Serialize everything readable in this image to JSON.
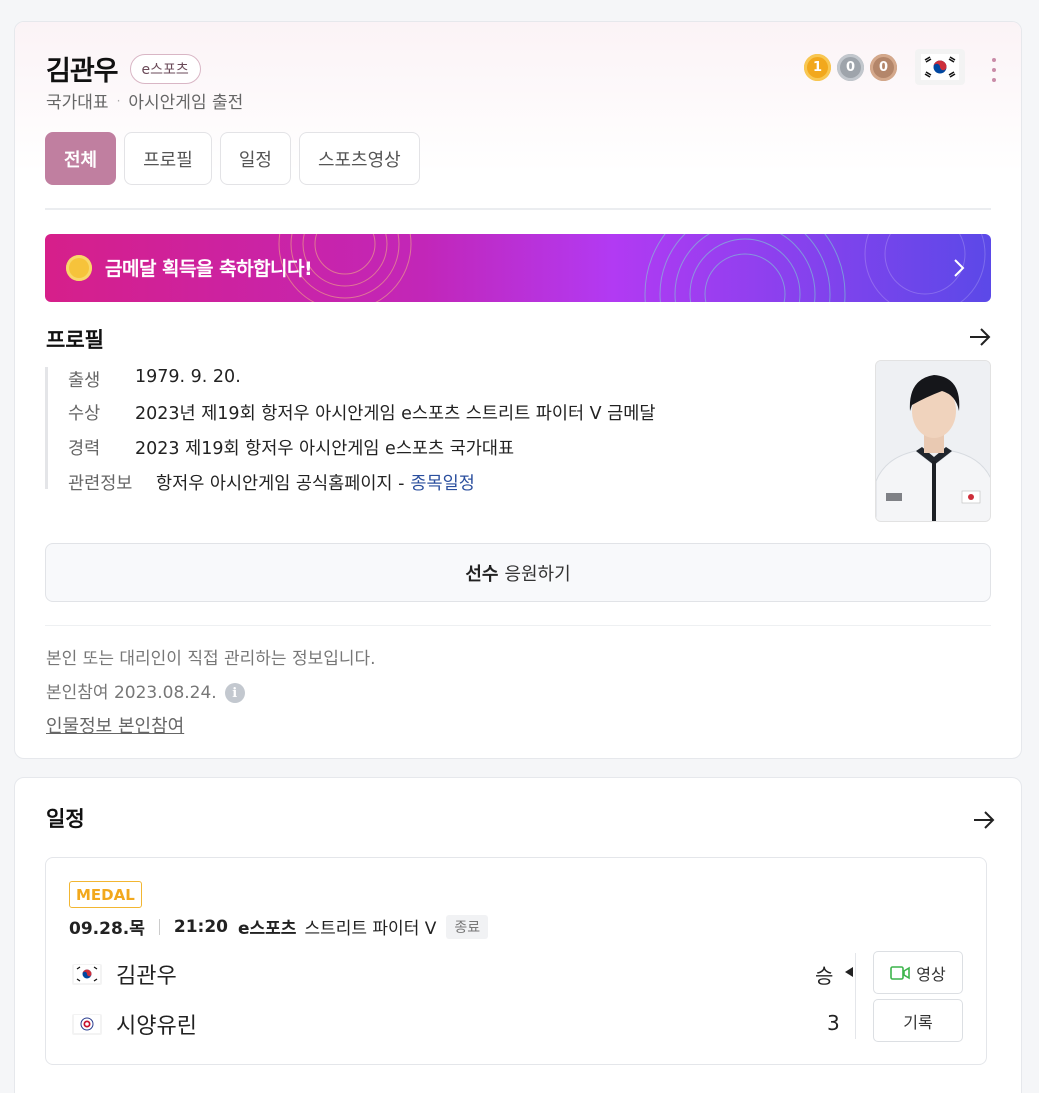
{
  "player": {
    "name": "김관우",
    "tag": "e스포츠",
    "sub1": "국가대표",
    "sub2": "아시안게임 출전",
    "medals": {
      "gold": "1",
      "silver": "0",
      "bronze": "0"
    }
  },
  "tabs": [
    {
      "label": "전체",
      "active": true
    },
    {
      "label": "프로필"
    },
    {
      "label": "일정"
    },
    {
      "label": "스포츠영상"
    }
  ],
  "banner": {
    "text": "금메달 획득을 축하합니다!"
  },
  "profile": {
    "title": "프로필",
    "rows": [
      {
        "label": "출생",
        "value": "1979. 9. 20."
      },
      {
        "label": "수상",
        "value": "2023년 제19회 항저우 아시안게임 e스포츠 스트리트 파이터 V 금메달"
      },
      {
        "label": "경력",
        "value": "2023 제19회 항저우 아시안게임 e스포츠 국가대표"
      },
      {
        "label": "관련정보",
        "value": "항저우 아시안게임 공식홈페이지 -",
        "link": "종목일정"
      }
    ],
    "cheer_bold": "선수",
    "cheer_rest": "응원하기",
    "note1": "본인 또는 대리인이 직접 관리하는 정보입니다.",
    "note2": "본인참여 2023.08.24.",
    "info_glyph": "i",
    "manage_link": "인물정보 본인참여"
  },
  "schedule": {
    "title": "일정",
    "game": {
      "badge": "MEDAL",
      "date": "09.28.목",
      "time": "21:20",
      "sport": "e스포츠",
      "event": "스트리트 파이터 V",
      "status": "종료",
      "team1": {
        "name": "김관우",
        "score": "승"
      },
      "team2": {
        "name": "시양유린",
        "score": "3"
      },
      "video_label": "영상",
      "record_label": "기록"
    }
  },
  "colors": {
    "accent": "#c07fa0",
    "gold": "#f2a81d",
    "link": "#2b4f9e"
  }
}
